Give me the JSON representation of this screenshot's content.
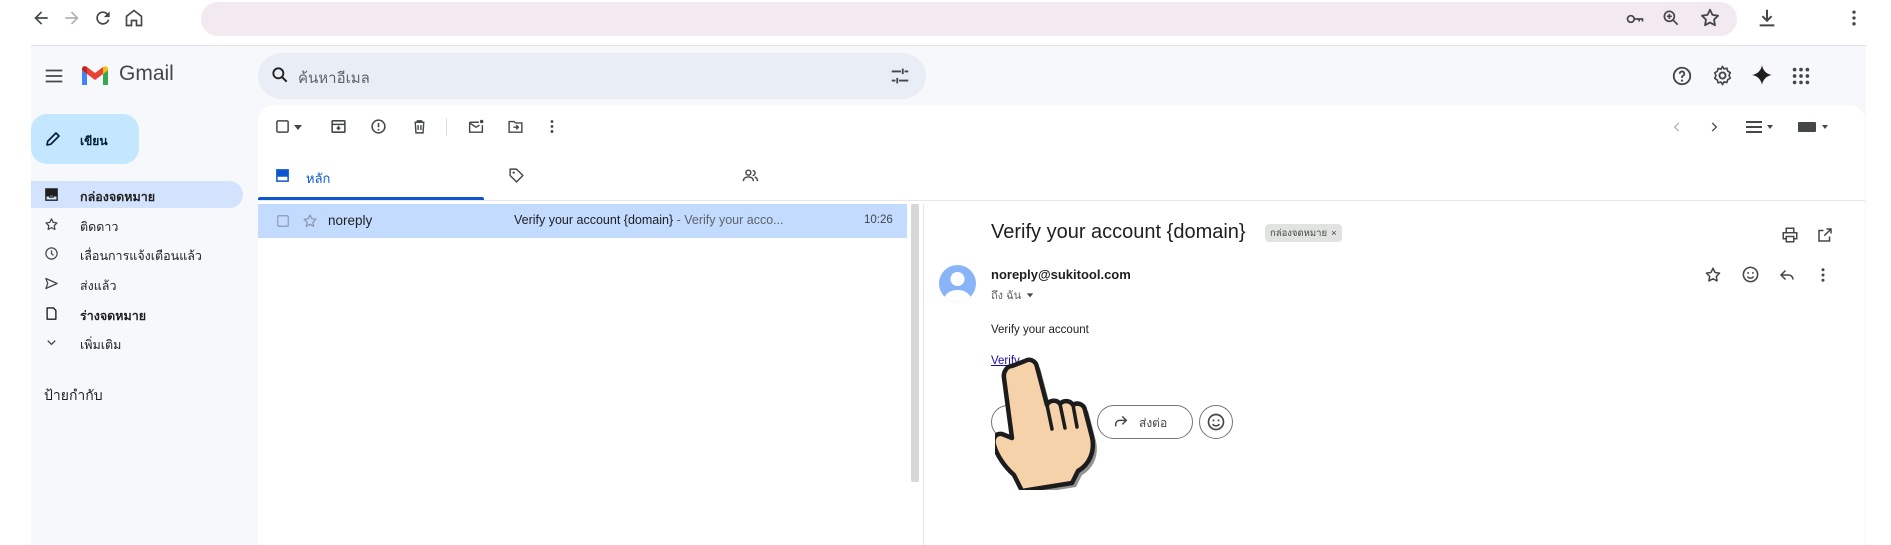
{
  "browser": {
    "nav_icons": [
      "back-icon",
      "forward-icon",
      "reload-icon",
      "home-icon"
    ],
    "right_icons": [
      "key-icon",
      "zoom-icon",
      "bookmark-star-icon",
      "download-icon",
      "menu-dots-icon"
    ]
  },
  "gmail": {
    "brand": "Gmail",
    "search_placeholder": "ค้นหาอีเมล",
    "compose_label": "เขียน",
    "nav": [
      {
        "label": "กล่องจดหมาย",
        "icon": "inbox-icon",
        "active": true,
        "bold": true
      },
      {
        "label": "ติดดาว",
        "icon": "star-icon",
        "active": false,
        "bold": false
      },
      {
        "label": "เลื่อนการแจ้งเตือนแล้ว",
        "icon": "clock-icon",
        "active": false,
        "bold": false
      },
      {
        "label": "ส่งแล้ว",
        "icon": "send-icon",
        "active": false,
        "bold": false
      },
      {
        "label": "ร่างจดหมาย",
        "icon": "draft-icon",
        "active": false,
        "bold": true
      },
      {
        "label": "เพิ่มเติม",
        "icon": "chevron-down-icon",
        "active": false,
        "bold": false
      }
    ],
    "labels_heading": "ป้ายกำกับ",
    "tabs": [
      {
        "label": "หลัก",
        "icon": "inbox-tab-icon",
        "selected": true
      },
      {
        "label": "",
        "icon": "tag-icon",
        "selected": false
      },
      {
        "label": "",
        "icon": "people-icon",
        "selected": false
      }
    ],
    "email_list": [
      {
        "sender": "noreply",
        "subject": "Verify your account {domain}",
        "snippet": " - Verify your acco...",
        "time": "10:26"
      }
    ],
    "reading_pane": {
      "subject": "Verify your account {domain}",
      "label_chip": "กล่องจดหมาย",
      "label_chip_close": "×",
      "from": "noreply@sukitool.com",
      "to": "ถึง ฉัน",
      "body_text": "Verify your account",
      "link_text": "Verify",
      "forward_label": "ส่งต่อ"
    }
  },
  "colors": {
    "accent": "#0b57d0",
    "selected_row": "#c2dbff",
    "compose": "#c2e7ff",
    "active_nav": "#d3e3fd"
  }
}
